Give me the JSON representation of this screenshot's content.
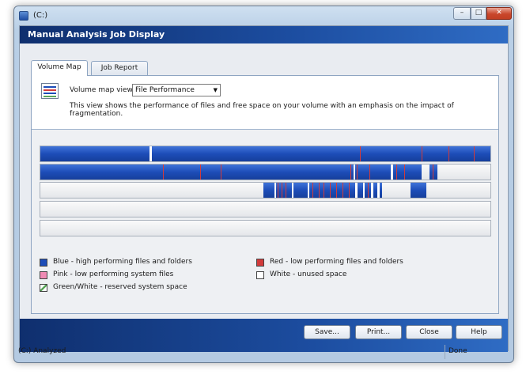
{
  "window": {
    "title": "(C:)",
    "min": "–",
    "max": "□",
    "close": "✕"
  },
  "header": {
    "title": "Manual Analysis Job Display"
  },
  "tabs": [
    {
      "label": "Volume Map",
      "active": true
    },
    {
      "label": "Job Report",
      "active": false
    }
  ],
  "view": {
    "label": "Volume map view:",
    "selected": "File Performance",
    "description": "This view shows the performance of files and free space on your volume with an emphasis on the impact of fragmentation."
  },
  "legend": {
    "blue": "Blue - high performing files and folders",
    "red": "Red - low performing files and folders",
    "pink": "Pink - low performing system files",
    "white": "White - unused space",
    "green": "Green/White - reserved system space"
  },
  "colors": {
    "blue": "#1d4db8",
    "red": "#d23b3b",
    "pink": "#f08ab4",
    "white": "#ffffff",
    "green": "#5aa65a"
  },
  "buttons": {
    "save": "Save...",
    "print": "Print...",
    "close": "Close",
    "help": "Help"
  },
  "status": {
    "left": "(C:) Analyzed",
    "right": "Done"
  }
}
